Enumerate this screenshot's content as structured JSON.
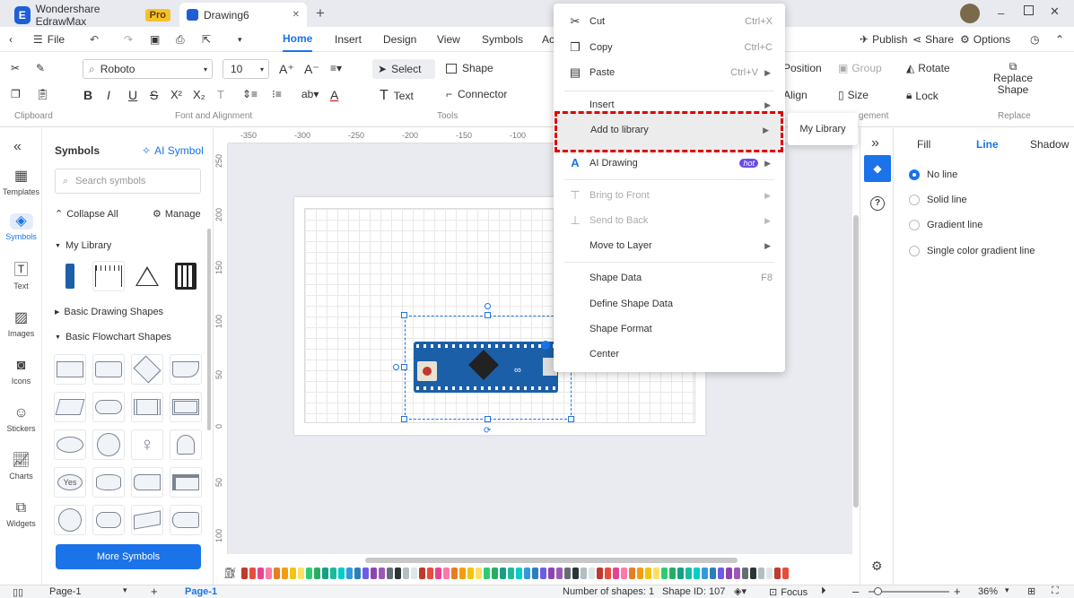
{
  "titlebar": {
    "app_tab": "Wondershare EdrawMax",
    "pro_badge": "Pro",
    "doc_tab": "Drawing6",
    "close_symbol": "✕",
    "new_tab_symbol": "+"
  },
  "menubar": {
    "file": "File",
    "tabs": [
      "Home",
      "Insert",
      "Design",
      "View",
      "Symbols",
      "Ac"
    ],
    "publish": "Publish",
    "share": "Share",
    "options": "Options"
  },
  "ribbon": {
    "font_name": "Roboto",
    "font_size": "10",
    "select": "Select",
    "shape": "Shape",
    "text": "Text",
    "connector": "Connector",
    "position": "Position",
    "group": "Group",
    "rotate": "Rotate",
    "align": "Align",
    "size": "Size",
    "lock": "Lock",
    "replace_shape": "Replace Shape",
    "groups": {
      "clipboard": "Clipboard",
      "font": "Font and Alignment",
      "tools": "Tools",
      "arrangement": "gement",
      "replace": "Replace"
    },
    "format_buttons": [
      "B",
      "I",
      "U",
      "S",
      "X²",
      "X₂",
      "T"
    ]
  },
  "rail": [
    {
      "label": "Templates",
      "icon": "templates-icon"
    },
    {
      "label": "Symbols",
      "icon": "symbols-icon"
    },
    {
      "label": "Text",
      "icon": "text-icon"
    },
    {
      "label": "Images",
      "icon": "images-icon"
    },
    {
      "label": "Icons",
      "icon": "icons-icon"
    },
    {
      "label": "Stickers",
      "icon": "stickers-icon"
    },
    {
      "label": "Charts",
      "icon": "charts-icon"
    },
    {
      "label": "Widgets",
      "icon": "widgets-icon"
    }
  ],
  "library": {
    "title": "Symbols",
    "ai_symbol": "AI Symbol",
    "search_placeholder": "Search symbols",
    "collapse_all": "Collapse All",
    "manage": "Manage",
    "my_library": "My Library",
    "basic_drawing": "Basic Drawing Shapes",
    "basic_flowchart": "Basic Flowchart Shapes",
    "yes_label": "Yes",
    "more_symbols": "More Symbols"
  },
  "ruler_top": [
    "-350",
    "-300",
    "-250",
    "-200",
    "-150",
    "-100"
  ],
  "ruler_left": [
    "250",
    "200",
    "150",
    "100",
    "50",
    "0",
    "50",
    "100"
  ],
  "context_menu": {
    "items": [
      {
        "label": "Cut",
        "shortcut": "Ctrl+X",
        "icon": "scissors-icon"
      },
      {
        "label": "Copy",
        "shortcut": "Ctrl+C",
        "icon": "copy-icon"
      },
      {
        "label": "Paste",
        "shortcut": "Ctrl+V",
        "icon": "paste-icon"
      },
      {
        "label": "Insert"
      },
      {
        "label": "Add to library"
      },
      {
        "label": "AI Drawing",
        "badge": "hot"
      },
      {
        "label": "Bring to Front"
      },
      {
        "label": "Send to Back"
      },
      {
        "label": "Move to Layer"
      },
      {
        "label": "Shape Data",
        "shortcut": "F8"
      },
      {
        "label": "Define Shape Data"
      },
      {
        "label": "Shape Format"
      },
      {
        "label": "Center"
      }
    ],
    "submenu": "My Library"
  },
  "right_panel": {
    "tabs": [
      "Fill",
      "Line",
      "Shadow"
    ],
    "options": [
      "No line",
      "Solid line",
      "Gradient line",
      "Single color gradient line"
    ]
  },
  "status": {
    "page_select": "Page-1",
    "page_tab": "Page-1",
    "shapes": "Number of shapes: 1",
    "shape_id": "Shape ID: 107",
    "focus": "Focus",
    "zoom": "36%"
  },
  "colors": {
    "accent": "#1a73e8",
    "highlight": "#e00000",
    "board": "#1b5fa8"
  }
}
